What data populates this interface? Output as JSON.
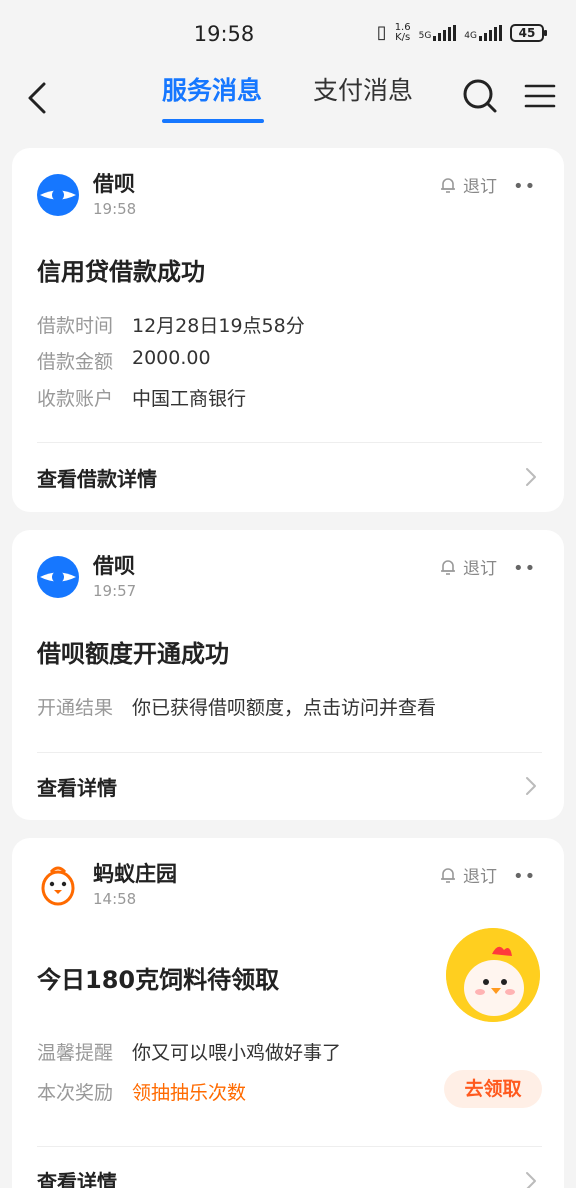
{
  "status_bar": {
    "time": "19:58",
    "speed_value": "1.6",
    "speed_unit": "K/s",
    "net_5g": "5G",
    "net_4g": "4G",
    "battery": "45"
  },
  "nav": {
    "tabs": [
      {
        "label": "服务消息",
        "active": true
      },
      {
        "label": "支付消息",
        "active": false
      }
    ]
  },
  "cards": [
    {
      "sender": "借呗",
      "time": "19:58",
      "unsubscribe": "退订",
      "title": "信用贷借款成功",
      "rows": [
        {
          "label": "借款时间",
          "value": "12月28日19点58分"
        },
        {
          "label": "借款金额",
          "value": "2000.00"
        },
        {
          "label": "收款账户",
          "value": "中国工商银行"
        }
      ],
      "footer": "查看借款详情"
    },
    {
      "sender": "借呗",
      "time": "19:57",
      "unsubscribe": "退订",
      "title": "借呗额度开通成功",
      "rows": [
        {
          "label": "开通结果",
          "value": "你已获得借呗额度，点击访问并查看"
        }
      ],
      "footer": "查看详情"
    },
    {
      "sender": "蚂蚁庄园",
      "time": "14:58",
      "unsubscribe": "退订",
      "title": "今日180克饲料待领取",
      "rows": [
        {
          "label": "温馨提醒",
          "value": "你又可以喂小鸡做好事了"
        },
        {
          "label": "本次奖励",
          "value": "领抽抽乐次数"
        }
      ],
      "claim_button": "去领取",
      "footer": "查看详情"
    }
  ],
  "colors": {
    "accent": "#1677ff",
    "reward": "#ff6a00",
    "background": "#f4f4f4"
  }
}
